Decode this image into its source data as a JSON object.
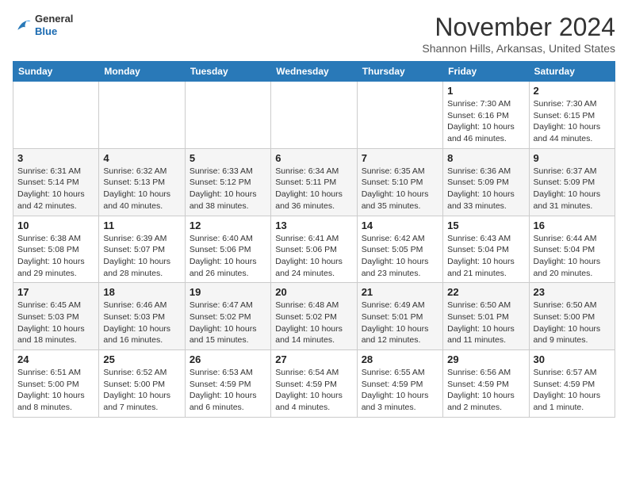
{
  "logo": {
    "general": "General",
    "blue": "Blue"
  },
  "header": {
    "month": "November 2024",
    "location": "Shannon Hills, Arkansas, United States"
  },
  "weekdays": [
    "Sunday",
    "Monday",
    "Tuesday",
    "Wednesday",
    "Thursday",
    "Friday",
    "Saturday"
  ],
  "weeks": [
    [
      {
        "day": "",
        "info": ""
      },
      {
        "day": "",
        "info": ""
      },
      {
        "day": "",
        "info": ""
      },
      {
        "day": "",
        "info": ""
      },
      {
        "day": "",
        "info": ""
      },
      {
        "day": "1",
        "info": "Sunrise: 7:30 AM\nSunset: 6:16 PM\nDaylight: 10 hours and 46 minutes."
      },
      {
        "day": "2",
        "info": "Sunrise: 7:30 AM\nSunset: 6:15 PM\nDaylight: 10 hours and 44 minutes."
      }
    ],
    [
      {
        "day": "3",
        "info": "Sunrise: 6:31 AM\nSunset: 5:14 PM\nDaylight: 10 hours and 42 minutes."
      },
      {
        "day": "4",
        "info": "Sunrise: 6:32 AM\nSunset: 5:13 PM\nDaylight: 10 hours and 40 minutes."
      },
      {
        "day": "5",
        "info": "Sunrise: 6:33 AM\nSunset: 5:12 PM\nDaylight: 10 hours and 38 minutes."
      },
      {
        "day": "6",
        "info": "Sunrise: 6:34 AM\nSunset: 5:11 PM\nDaylight: 10 hours and 36 minutes."
      },
      {
        "day": "7",
        "info": "Sunrise: 6:35 AM\nSunset: 5:10 PM\nDaylight: 10 hours and 35 minutes."
      },
      {
        "day": "8",
        "info": "Sunrise: 6:36 AM\nSunset: 5:09 PM\nDaylight: 10 hours and 33 minutes."
      },
      {
        "day": "9",
        "info": "Sunrise: 6:37 AM\nSunset: 5:09 PM\nDaylight: 10 hours and 31 minutes."
      }
    ],
    [
      {
        "day": "10",
        "info": "Sunrise: 6:38 AM\nSunset: 5:08 PM\nDaylight: 10 hours and 29 minutes."
      },
      {
        "day": "11",
        "info": "Sunrise: 6:39 AM\nSunset: 5:07 PM\nDaylight: 10 hours and 28 minutes."
      },
      {
        "day": "12",
        "info": "Sunrise: 6:40 AM\nSunset: 5:06 PM\nDaylight: 10 hours and 26 minutes."
      },
      {
        "day": "13",
        "info": "Sunrise: 6:41 AM\nSunset: 5:06 PM\nDaylight: 10 hours and 24 minutes."
      },
      {
        "day": "14",
        "info": "Sunrise: 6:42 AM\nSunset: 5:05 PM\nDaylight: 10 hours and 23 minutes."
      },
      {
        "day": "15",
        "info": "Sunrise: 6:43 AM\nSunset: 5:04 PM\nDaylight: 10 hours and 21 minutes."
      },
      {
        "day": "16",
        "info": "Sunrise: 6:44 AM\nSunset: 5:04 PM\nDaylight: 10 hours and 20 minutes."
      }
    ],
    [
      {
        "day": "17",
        "info": "Sunrise: 6:45 AM\nSunset: 5:03 PM\nDaylight: 10 hours and 18 minutes."
      },
      {
        "day": "18",
        "info": "Sunrise: 6:46 AM\nSunset: 5:03 PM\nDaylight: 10 hours and 16 minutes."
      },
      {
        "day": "19",
        "info": "Sunrise: 6:47 AM\nSunset: 5:02 PM\nDaylight: 10 hours and 15 minutes."
      },
      {
        "day": "20",
        "info": "Sunrise: 6:48 AM\nSunset: 5:02 PM\nDaylight: 10 hours and 14 minutes."
      },
      {
        "day": "21",
        "info": "Sunrise: 6:49 AM\nSunset: 5:01 PM\nDaylight: 10 hours and 12 minutes."
      },
      {
        "day": "22",
        "info": "Sunrise: 6:50 AM\nSunset: 5:01 PM\nDaylight: 10 hours and 11 minutes."
      },
      {
        "day": "23",
        "info": "Sunrise: 6:50 AM\nSunset: 5:00 PM\nDaylight: 10 hours and 9 minutes."
      }
    ],
    [
      {
        "day": "24",
        "info": "Sunrise: 6:51 AM\nSunset: 5:00 PM\nDaylight: 10 hours and 8 minutes."
      },
      {
        "day": "25",
        "info": "Sunrise: 6:52 AM\nSunset: 5:00 PM\nDaylight: 10 hours and 7 minutes."
      },
      {
        "day": "26",
        "info": "Sunrise: 6:53 AM\nSunset: 4:59 PM\nDaylight: 10 hours and 6 minutes."
      },
      {
        "day": "27",
        "info": "Sunrise: 6:54 AM\nSunset: 4:59 PM\nDaylight: 10 hours and 4 minutes."
      },
      {
        "day": "28",
        "info": "Sunrise: 6:55 AM\nSunset: 4:59 PM\nDaylight: 10 hours and 3 minutes."
      },
      {
        "day": "29",
        "info": "Sunrise: 6:56 AM\nSunset: 4:59 PM\nDaylight: 10 hours and 2 minutes."
      },
      {
        "day": "30",
        "info": "Sunrise: 6:57 AM\nSunset: 4:59 PM\nDaylight: 10 hours and 1 minute."
      }
    ]
  ]
}
